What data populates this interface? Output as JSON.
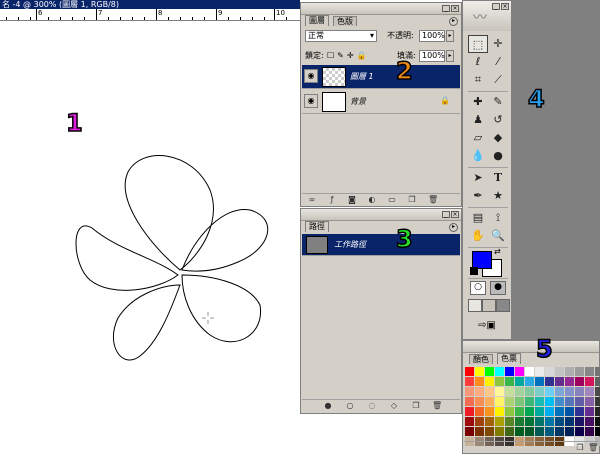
{
  "canvas": {
    "title": "名 -4 @ 300% (圖層 1, RGB/8)",
    "ruler_numbers": [
      "6",
      "7",
      "8",
      "9",
      "10"
    ]
  },
  "layers_panel": {
    "tabs": [
      "圖層",
      "色版"
    ],
    "blend_mode": "正常",
    "opacity_label": "不透明:",
    "opacity_value": "100%",
    "lock_label": "鎖定:",
    "fill_label": "填滿:",
    "fill_value": "100%",
    "layers": [
      {
        "name": "圖層 1",
        "selected": true
      },
      {
        "name": "背景",
        "selected": false
      }
    ]
  },
  "paths_panel": {
    "tab": "路徑",
    "paths": [
      {
        "name": "工作路徑",
        "selected": true
      }
    ]
  },
  "toolbox": {
    "tools": [
      "marquee-icon",
      "move-icon",
      "lasso-icon",
      "magic-wand-icon",
      "crop-icon",
      "slice-icon",
      "healing-brush-icon",
      "brush-icon",
      "clone-stamp-icon",
      "history-brush-icon",
      "eraser-icon",
      "paint-bucket-icon",
      "blur-icon",
      "dodge-icon",
      "path-selection-icon",
      "type-icon",
      "pen-icon",
      "custom-shape-icon",
      "notes-icon",
      "eyedropper-icon",
      "hand-icon",
      "zoom-icon"
    ],
    "foreground_color": "#0000ff",
    "background_color": "#ffffff"
  },
  "swatches_panel": {
    "tabs": [
      "顏色",
      "色票"
    ],
    "colors": [
      "#ff0000",
      "#ffff00",
      "#00ff00",
      "#00ffff",
      "#0000ff",
      "#ff00ff",
      "#ffffff",
      "#ebebeb",
      "#d7d7d7",
      "#c3c3c3",
      "#afafaf",
      "#9b9b9b",
      "#878787",
      "#737373",
      "#ff3b3b",
      "#ff8c1a",
      "#fff200",
      "#8cc63f",
      "#39b54a",
      "#00a99d",
      "#29abe2",
      "#0071bc",
      "#2e3192",
      "#662d91",
      "#92278f",
      "#9e005d",
      "#d4145a",
      "#5f5f5f",
      "#f7977a",
      "#f9ad81",
      "#fdc68a",
      "#fff79a",
      "#c4df9b",
      "#a2d39c",
      "#82ca9d",
      "#7bcdc8",
      "#6ecff6",
      "#7ea7d8",
      "#8493ca",
      "#8882be",
      "#a187be",
      "#4b4b4b",
      "#f26c4f",
      "#f68e55",
      "#fbaf5c",
      "#fff467",
      "#acd372",
      "#7cc576",
      "#3bb878",
      "#1abbb4",
      "#00bff3",
      "#438ccb",
      "#5574b9",
      "#605ca8",
      "#855fa8",
      "#373737",
      "#ed1c24",
      "#f26522",
      "#f7941d",
      "#fff200",
      "#8dc73f",
      "#39b54a",
      "#00a651",
      "#00a99d",
      "#00aeef",
      "#0072bc",
      "#0054a6",
      "#2e3192",
      "#662d91",
      "#232323",
      "#9e0b0f",
      "#a0410d",
      "#a3620a",
      "#aba000",
      "#598527",
      "#1a7b30",
      "#007236",
      "#00746b",
      "#0076a3",
      "#004b80",
      "#003471",
      "#1b1464",
      "#440e62",
      "#0f0f0f",
      "#790000",
      "#7b2e00",
      "#7d4900",
      "#827b00",
      "#406618",
      "#005e20",
      "#005826",
      "#005952",
      "#005b7f",
      "#003663",
      "#002157",
      "#0d004c",
      "#32004b",
      "#000000",
      "#c7b299",
      "#998675",
      "#736357",
      "#534741",
      "#37302d",
      "#c69c6d",
      "#a67c52",
      "#8c6239",
      "#754c24",
      "#603913",
      "#ffffff",
      "#e6e6e6",
      "#cccccc",
      "#b3b3b3"
    ]
  },
  "markers": [
    "1",
    "2",
    "3",
    "4",
    "5"
  ]
}
